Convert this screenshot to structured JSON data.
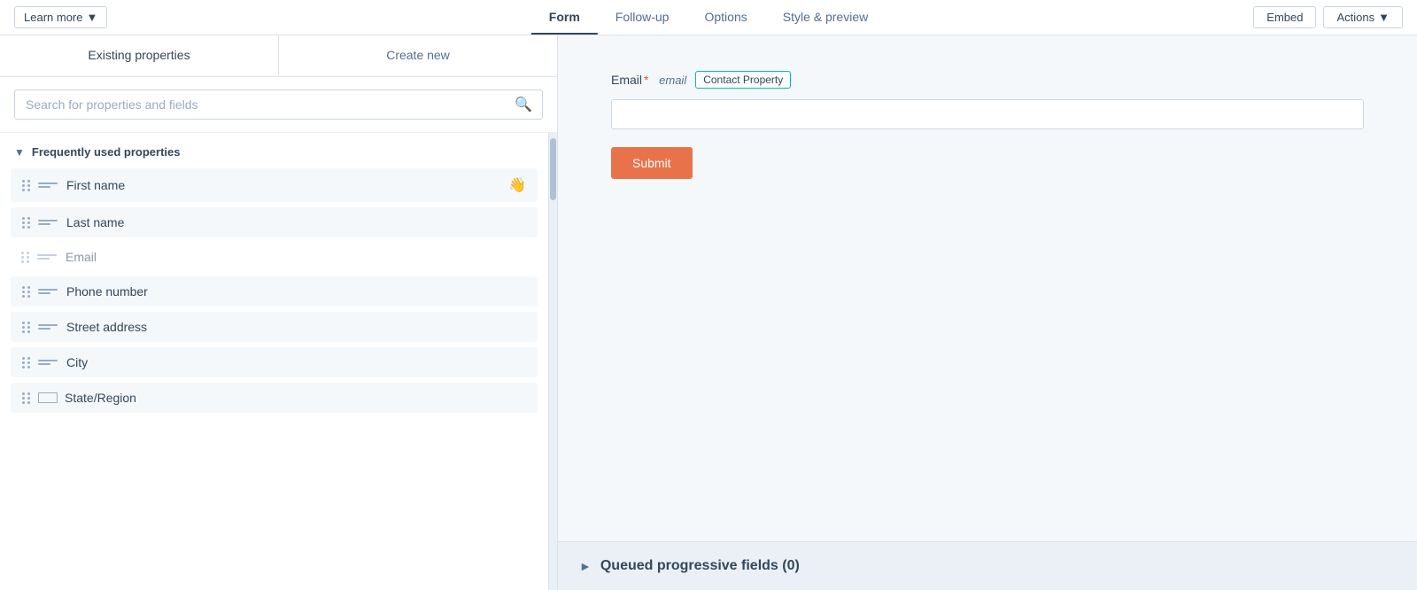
{
  "topbar": {
    "learn_more_label": "Learn more",
    "tabs": [
      {
        "id": "form",
        "label": "Form",
        "active": true
      },
      {
        "id": "follow-up",
        "label": "Follow-up",
        "active": false
      },
      {
        "id": "options",
        "label": "Options",
        "active": false
      },
      {
        "id": "style-preview",
        "label": "Style & preview",
        "active": false
      }
    ],
    "embed_label": "Embed",
    "actions_label": "Actions"
  },
  "left_panel": {
    "tab_existing": "Existing properties",
    "tab_create": "Create new",
    "search_placeholder": "Search for properties and fields",
    "section_label": "Frequently used properties",
    "properties": [
      {
        "id": "first-name",
        "label": "First name",
        "icon": "lines",
        "draggable": true,
        "disabled": false,
        "show_cursor": true
      },
      {
        "id": "last-name",
        "label": "Last name",
        "icon": "lines",
        "draggable": true,
        "disabled": false,
        "show_cursor": false
      },
      {
        "id": "email",
        "label": "Email",
        "icon": "lines",
        "draggable": false,
        "disabled": true,
        "show_cursor": false
      },
      {
        "id": "phone-number",
        "label": "Phone number",
        "icon": "lines",
        "draggable": true,
        "disabled": false,
        "show_cursor": false
      },
      {
        "id": "street-address",
        "label": "Street address",
        "icon": "lines",
        "draggable": true,
        "disabled": false,
        "show_cursor": false
      },
      {
        "id": "city",
        "label": "City",
        "icon": "lines",
        "draggable": true,
        "disabled": false,
        "show_cursor": false
      },
      {
        "id": "state-region",
        "label": "State/Region",
        "icon": "rect",
        "draggable": true,
        "disabled": false,
        "show_cursor": false
      }
    ]
  },
  "form_canvas": {
    "email_label": "Email",
    "email_required": "*",
    "email_type": "email",
    "contact_property_label": "Contact Property",
    "submit_label": "Submit",
    "queued_label": "Queued progressive fields (0)"
  }
}
